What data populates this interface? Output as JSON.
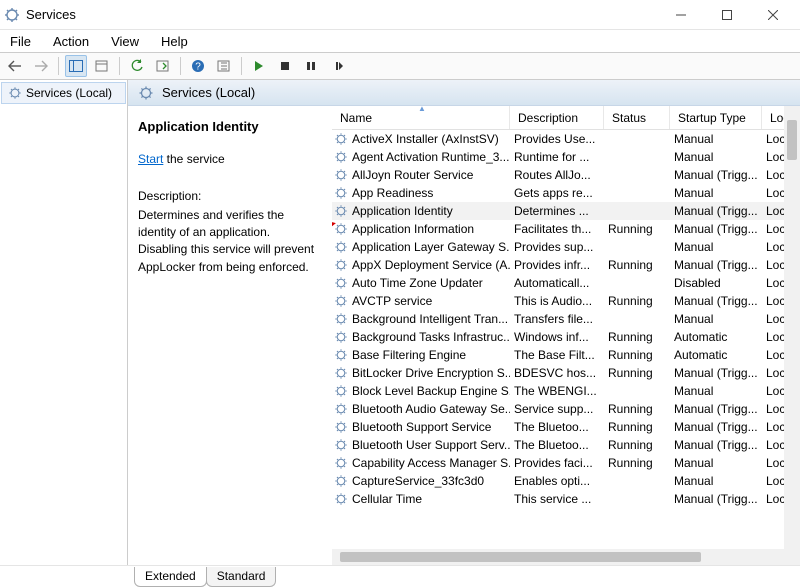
{
  "window": {
    "title": "Services"
  },
  "menu": {
    "file": "File",
    "action": "Action",
    "view": "View",
    "help": "Help"
  },
  "tree": {
    "root": "Services (Local)"
  },
  "right_header": {
    "title": "Services (Local)"
  },
  "detail": {
    "title": "Application Identity",
    "start_link": "Start",
    "start_suffix": " the service",
    "desc_label": "Description:",
    "desc_text": "Determines and verifies the identity of an application. Disabling this service will prevent AppLocker from being enforced."
  },
  "columns": {
    "name": "Name",
    "description": "Description",
    "status": "Status",
    "startup": "Startup Type",
    "logon": "Log"
  },
  "services": [
    {
      "name": "ActiveX Installer (AxInstSV)",
      "description": "Provides Use...",
      "status": "",
      "startup": "Manual",
      "logon": "Loc",
      "sel": false
    },
    {
      "name": "Agent Activation Runtime_3...",
      "description": "Runtime for ...",
      "status": "",
      "startup": "Manual",
      "logon": "Loc",
      "sel": false
    },
    {
      "name": "AllJoyn Router Service",
      "description": "Routes AllJo...",
      "status": "",
      "startup": "Manual (Trigg...",
      "logon": "Loc",
      "sel": false
    },
    {
      "name": "App Readiness",
      "description": "Gets apps re...",
      "status": "",
      "startup": "Manual",
      "logon": "Loc",
      "sel": false
    },
    {
      "name": "Application Identity",
      "description": "Determines ...",
      "status": "",
      "startup": "Manual (Trigg...",
      "logon": "Loc",
      "sel": true
    },
    {
      "name": "Application Information",
      "description": "Facilitates th...",
      "status": "Running",
      "startup": "Manual (Trigg...",
      "logon": "Loc",
      "sel": false
    },
    {
      "name": "Application Layer Gateway S...",
      "description": "Provides sup...",
      "status": "",
      "startup": "Manual",
      "logon": "Loc",
      "sel": false
    },
    {
      "name": "AppX Deployment Service (A...",
      "description": "Provides infr...",
      "status": "Running",
      "startup": "Manual (Trigg...",
      "logon": "Loc",
      "sel": false
    },
    {
      "name": "Auto Time Zone Updater",
      "description": "Automaticall...",
      "status": "",
      "startup": "Disabled",
      "logon": "Loc",
      "sel": false
    },
    {
      "name": "AVCTP service",
      "description": "This is Audio...",
      "status": "Running",
      "startup": "Manual (Trigg...",
      "logon": "Loc",
      "sel": false
    },
    {
      "name": "Background Intelligent Tran...",
      "description": "Transfers file...",
      "status": "",
      "startup": "Manual",
      "logon": "Loc",
      "sel": false
    },
    {
      "name": "Background Tasks Infrastruc...",
      "description": "Windows inf...",
      "status": "Running",
      "startup": "Automatic",
      "logon": "Loc",
      "sel": false
    },
    {
      "name": "Base Filtering Engine",
      "description": "The Base Filt...",
      "status": "Running",
      "startup": "Automatic",
      "logon": "Loc",
      "sel": false
    },
    {
      "name": "BitLocker Drive Encryption S...",
      "description": "BDESVC hos...",
      "status": "Running",
      "startup": "Manual (Trigg...",
      "logon": "Loc",
      "sel": false
    },
    {
      "name": "Block Level Backup Engine S...",
      "description": "The WBENGI...",
      "status": "",
      "startup": "Manual",
      "logon": "Loc",
      "sel": false
    },
    {
      "name": "Bluetooth Audio Gateway Se...",
      "description": "Service supp...",
      "status": "Running",
      "startup": "Manual (Trigg...",
      "logon": "Loc",
      "sel": false
    },
    {
      "name": "Bluetooth Support Service",
      "description": "The Bluetoo...",
      "status": "Running",
      "startup": "Manual (Trigg...",
      "logon": "Loc",
      "sel": false
    },
    {
      "name": "Bluetooth User Support Serv...",
      "description": "The Bluetoo...",
      "status": "Running",
      "startup": "Manual (Trigg...",
      "logon": "Loc",
      "sel": false
    },
    {
      "name": "Capability Access Manager S...",
      "description": "Provides faci...",
      "status": "Running",
      "startup": "Manual",
      "logon": "Loc",
      "sel": false
    },
    {
      "name": "CaptureService_33fc3d0",
      "description": "Enables opti...",
      "status": "",
      "startup": "Manual",
      "logon": "Loc",
      "sel": false
    },
    {
      "name": "Cellular Time",
      "description": "This service ...",
      "status": "",
      "startup": "Manual (Trigg...",
      "logon": "Loc",
      "sel": false
    }
  ],
  "tabs": {
    "extended": "Extended",
    "standard": "Standard"
  }
}
